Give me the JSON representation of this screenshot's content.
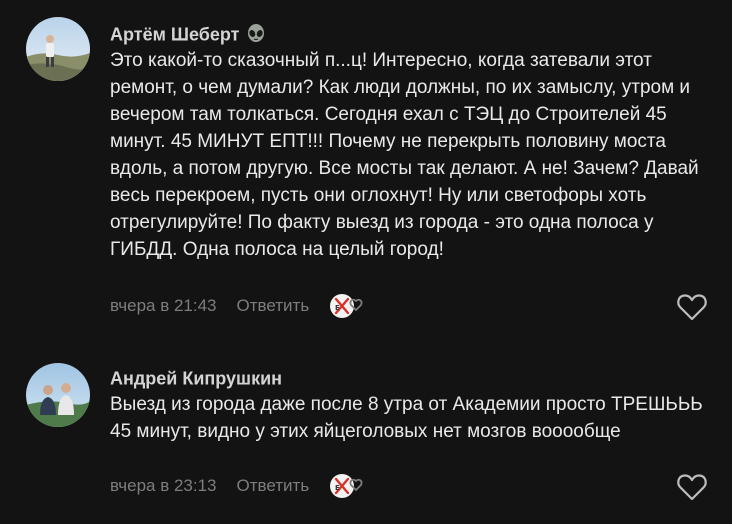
{
  "comments": [
    {
      "author": "Артём Шеберт",
      "badge_icon": "alien-icon",
      "text": "Это какой-то сказочный п...ц! Интересно, когда затевали этот ремонт, о чем думали? Как люди должны, по их замыслу, утром и вечером там толкаться. Сегодня ехал с ТЭЦ до Строителей 45 минут. 45 МИНУТ ЕПТ!!! Почему не перекрыть половину моста вдоль, а потом другую. Все мосты так делают. А не! Зачем? Давай весь перекроем, пусть они оглохнут! Ну или светофоры хоть отрегулируйте! По факту выезд из города - это одна полоса у ГИБДД. Одна полоса на целый город!",
      "time": "вчера в 21:43",
      "reply_label": "Ответить",
      "reaction_icon": "reaction-stickers-icon",
      "like_icon": "heart-outline-icon"
    },
    {
      "author": "Андрей Кипрушкин",
      "text": "Выезд из города даже после 8 утра от Академии просто ТРЕШЬЬЬ 45 минут, видно у этих яйцеголовых нет мозгов вооообще",
      "time": "вчера в 23:13",
      "reply_label": "Ответить",
      "reaction_icon": "reaction-stickers-icon",
      "like_icon": "heart-outline-icon"
    }
  ],
  "colors": {
    "background": "#131313",
    "text": "#e9e9e9",
    "author": "#d4d4d4",
    "meta": "#7d7d7d"
  }
}
